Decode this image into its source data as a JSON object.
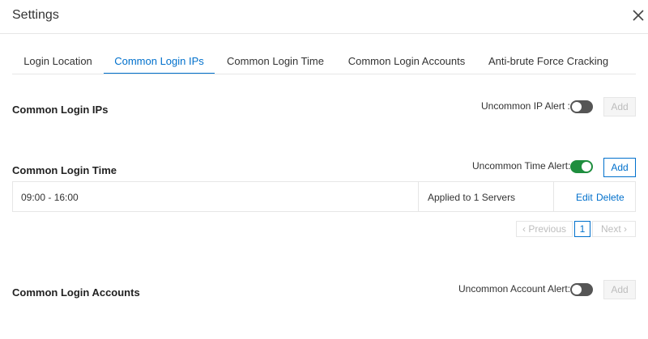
{
  "header": {
    "title": "Settings"
  },
  "tabs": [
    {
      "label": "Login Location",
      "active": false
    },
    {
      "label": "Common Login IPs",
      "active": true
    },
    {
      "label": "Common Login Time",
      "active": false
    },
    {
      "label": "Common Login Accounts",
      "active": false
    },
    {
      "label": "Anti-brute Force Cracking",
      "active": false
    }
  ],
  "sections": {
    "ips": {
      "title": "Common Login IPs",
      "alert_label": "Uncommon IP Alert :",
      "alert_on": false,
      "add_label": "Add"
    },
    "time": {
      "title": "Common Login Time",
      "alert_label": "Uncommon Time Alert:",
      "alert_on": true,
      "add_label": "Add",
      "rows": [
        {
          "time": "09:00 - 16:00",
          "applied": "Applied to 1 Servers",
          "edit": "Edit",
          "delete": "Delete"
        }
      ],
      "pagination": {
        "prev": "Previous",
        "page": "1",
        "next": "Next"
      }
    },
    "accounts": {
      "title": "Common Login Accounts",
      "alert_label": "Uncommon Account Alert:",
      "alert_on": false,
      "add_label": "Add"
    }
  },
  "colors": {
    "accent": "#0070cc",
    "toggle_on": "#1e8e3e",
    "toggle_off": "#555555"
  }
}
